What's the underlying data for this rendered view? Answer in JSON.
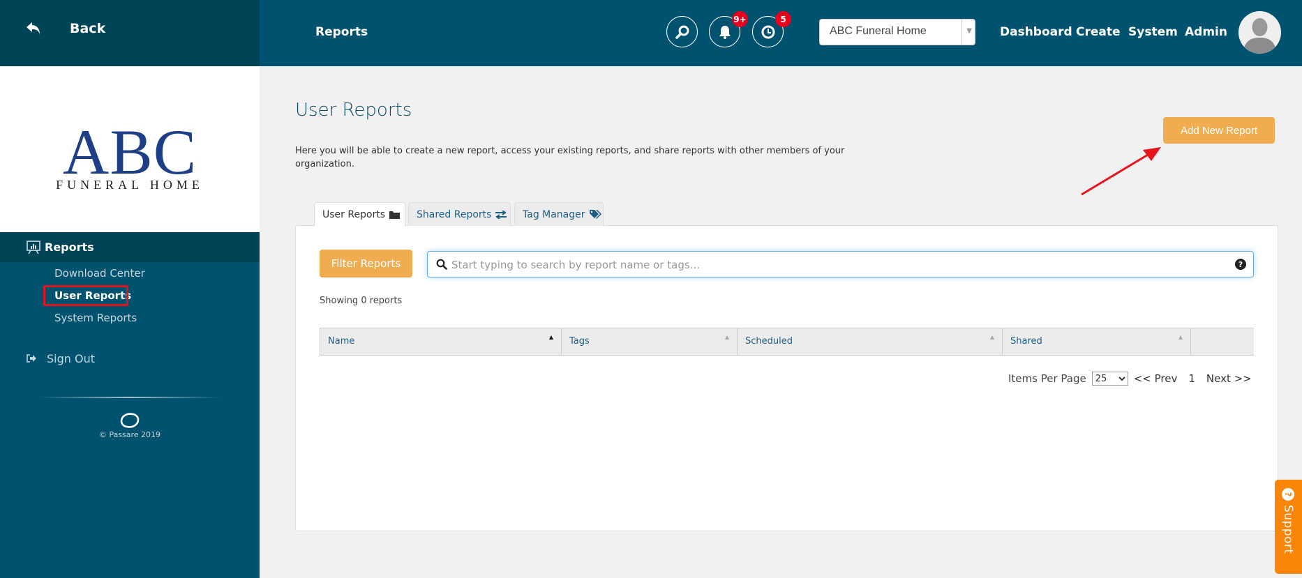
{
  "header": {
    "back_label": "Back",
    "section_title": "Reports",
    "icons": {
      "search": "search-icon",
      "notifications": "bell-icon",
      "history": "clock-icon"
    },
    "notifications_badge": "9+",
    "history_badge": "5",
    "org_select": {
      "value": "ABC Funeral Home"
    },
    "nav": [
      "Dashboard",
      "Create",
      "System",
      "Admin"
    ]
  },
  "sidebar": {
    "logo": {
      "title": "ABC",
      "subtitle": "FUNERAL HOME"
    },
    "section_label": "Reports",
    "items": [
      {
        "label": "Download Center",
        "active": false
      },
      {
        "label": "User Reports",
        "active": true
      },
      {
        "label": "System Reports",
        "active": false
      }
    ],
    "sign_out_label": "Sign Out",
    "copyright": "© Passare 2019"
  },
  "main": {
    "title": "User Reports",
    "description": "Here you will be able to create a new report, access your existing reports, and share reports with other members of your organization.",
    "add_button": "Add New Report",
    "tabs": [
      {
        "label": "User Reports",
        "icon": "folder-icon",
        "active": true
      },
      {
        "label": "Shared Reports",
        "icon": "exchange-icon",
        "active": false
      },
      {
        "label": "Tag Manager",
        "icon": "tags-icon",
        "active": false
      }
    ],
    "filter_button": "Filter Reports",
    "search": {
      "placeholder": "Start typing to search by report name or tags...",
      "value": ""
    },
    "showing_text": "Showing 0 reports",
    "table": {
      "columns": [
        "Name",
        "Tags",
        "Scheduled",
        "Shared",
        ""
      ],
      "rows": []
    },
    "pagination": {
      "items_per_page_label": "Items Per Page",
      "items_per_page": "25",
      "prev_label": "<< Prev",
      "current_page": "1",
      "next_label": "Next >>"
    }
  },
  "support_tab": {
    "label": "Support"
  },
  "colors": {
    "header_dark": "#004457",
    "header": "#00526f",
    "accent_orange": "#efad4f",
    "support_orange": "#f98509",
    "badge_red": "#e8001c",
    "highlight_red": "#e0141e"
  }
}
